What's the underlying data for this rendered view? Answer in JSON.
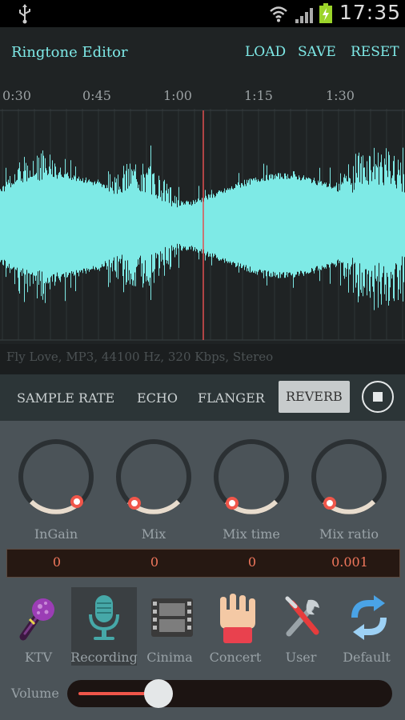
{
  "status": {
    "time": "17:35"
  },
  "header": {
    "title": "Ringtone Editor",
    "load": "LOAD",
    "save": "SAVE",
    "reset": "RESET"
  },
  "timeline": {
    "ticks": [
      "0:30",
      "0:45",
      "1:00",
      "1:15",
      "1:30"
    ]
  },
  "file_info": "Fly Love, MP3, 44100 Hz, 320 Kbps, Stereo",
  "effects": {
    "tabs": [
      "SAMPLE RATE",
      "ECHO",
      "FLANGER",
      "REVERB"
    ],
    "active": "REVERB"
  },
  "knobs": [
    {
      "label": "InGain",
      "value": "0"
    },
    {
      "label": "Mix",
      "value": "0"
    },
    {
      "label": "Mix time",
      "value": "0"
    },
    {
      "label": "Mix ratio",
      "value": "0.001"
    }
  ],
  "presets": [
    {
      "label": "KTV",
      "icon": "microphone-purple-icon"
    },
    {
      "label": "Recording",
      "icon": "studio-microphone-icon",
      "selected": true
    },
    {
      "label": "Cinima",
      "icon": "film-strip-icon"
    },
    {
      "label": "Concert",
      "icon": "concert-hands-icon"
    },
    {
      "label": "User",
      "icon": "tools-icon"
    },
    {
      "label": "Default",
      "icon": "refresh-icon"
    }
  ],
  "volume": {
    "label": "Volume",
    "level": 0.26
  },
  "colors": {
    "accent": "#7ee9e7",
    "waveform": "#7eeae6",
    "playhead": "#e05050",
    "value_text": "#f0775c"
  }
}
